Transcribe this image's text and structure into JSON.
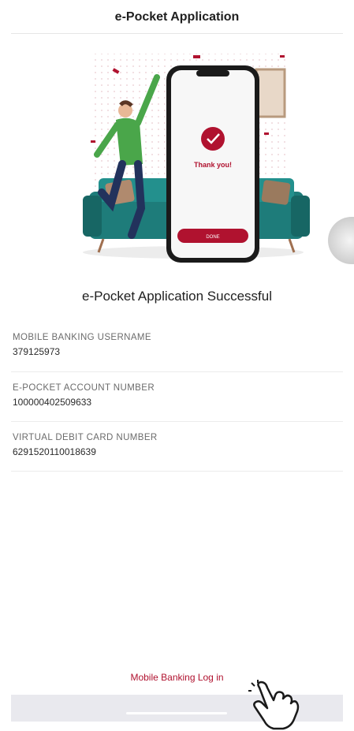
{
  "header": {
    "title": "e-Pocket Application"
  },
  "illustration": {
    "phone_message": "Thank you!",
    "phone_button_label": "DONE",
    "colors": {
      "brand": "#b0122f",
      "sofa": "#1e7c7a",
      "shirt": "#4aa64a",
      "pants": "#22325c"
    }
  },
  "main": {
    "success_title": "e-Pocket Application Successful",
    "items": [
      {
        "label": "MOBILE BANKING USERNAME",
        "value": "379125973"
      },
      {
        "label": "E-POCKET ACCOUNT NUMBER",
        "value": "100000402509633"
      },
      {
        "label": "VIRTUAL DEBIT CARD NUMBER",
        "value": "6291520110018639"
      }
    ]
  },
  "footer": {
    "login_link": "Mobile Banking Log in"
  },
  "icons": {
    "pointer": "hand-pointer-icon",
    "success": "check-circle-icon"
  },
  "colors": {
    "accent": "#b0122f",
    "divider": "#ececec",
    "bottom_bar": "#e9e9ee"
  }
}
